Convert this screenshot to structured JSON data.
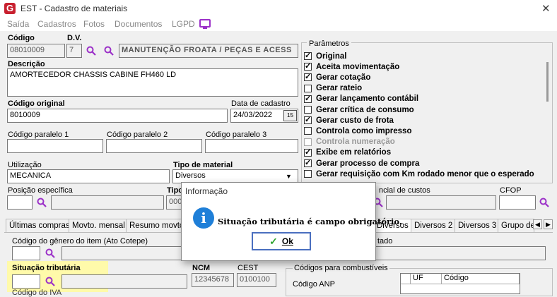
{
  "window": {
    "title": "EST - Cadastro de materiais",
    "logo_letter": "G",
    "close_glyph": "✕"
  },
  "menu": [
    "Saída",
    "Cadastros",
    "Fotos",
    "Documentos",
    "LGPD"
  ],
  "form": {
    "codigo_label": "Código",
    "codigo_value": "08010009",
    "dv_label": "D.V.",
    "dv_value": "7",
    "grupo_value": "MANUTENÇÃO FROATA / PEÇAS E ACESS",
    "descricao_label": "Descrição",
    "descricao_value": "AMORTECEDOR CHASSIS CABINE FH460 LD",
    "codigo_original_label": "Código original",
    "codigo_original_value": "8010009",
    "data_cadastro_label": "Data de cadastro",
    "data_cadastro_value": "24/03/2022",
    "calendar_glyph": "15",
    "codigo_paralelo_1_label": "Código paralelo 1",
    "codigo_paralelo_2_label": "Código paralelo 2",
    "codigo_paralelo_3_label": "Código paralelo 3",
    "utilizacao_label": "Utilização",
    "utilizacao_value": "MECANICA",
    "tipo_material_label": "Tipo de material",
    "tipo_material_value": "Diversos",
    "dropdown_glyph": "▼",
    "posicao_label": "Posição específica",
    "tipo_label_partial": "Tipo",
    "tipo_value_partial": "000",
    "centro_custos_label_partial": "ncial de custos",
    "cfop_label": "CFOP"
  },
  "params": {
    "title": "Parâmetros",
    "items": [
      {
        "label": "Original",
        "checked": true,
        "enabled": true
      },
      {
        "label": "Aceita movimentação",
        "checked": true,
        "enabled": true
      },
      {
        "label": "Gerar cotação",
        "checked": true,
        "enabled": true
      },
      {
        "label": "Gerar rateio",
        "checked": false,
        "enabled": true
      },
      {
        "label": "Gerar lançamento contábil",
        "checked": true,
        "enabled": true
      },
      {
        "label": "Gerar crítica de consumo",
        "checked": false,
        "enabled": true
      },
      {
        "label": "Gerar custo de frota",
        "checked": true,
        "enabled": true
      },
      {
        "label": "Controla como impresso",
        "checked": false,
        "enabled": true
      },
      {
        "label": "Controla numeração",
        "checked": false,
        "enabled": false
      },
      {
        "label": "Exibe em relatórios",
        "checked": true,
        "enabled": true
      },
      {
        "label": "Gerar processo de compra",
        "checked": true,
        "enabled": true
      },
      {
        "label": "Gerar requisição com Km rodado menor que o esperado",
        "checked": false,
        "enabled": true
      }
    ]
  },
  "tabs": [
    "Últimas compras",
    "Movto. mensal",
    "Resumo movto.",
    "Diversos",
    "Diversos 2",
    "Diversos 3",
    "Grupo de"
  ],
  "tab_arrows": [
    "◀",
    "▶"
  ],
  "lower": {
    "codigo_genero_label": "Código do gênero do item (Ato Cotepe)",
    "tado_label_partial": "tado",
    "situacao_label": "Situação tributária",
    "ncm_label": "NCM",
    "ncm_value": "12345678",
    "cest_label": "CEST",
    "cest_value": "0100100",
    "combustiveis_label": "Códigos para combustíveis",
    "codigo_anp_label": "Código ANP",
    "grid_headers": [
      "UF",
      "Código"
    ],
    "iva_label_partial": "Código do IVA"
  },
  "dialog": {
    "title": "Informação",
    "icon_glyph": "i",
    "message": "Situação tributária é campo obrigatório.",
    "ok_label": "Ok",
    "ok_glyph": "✓"
  }
}
